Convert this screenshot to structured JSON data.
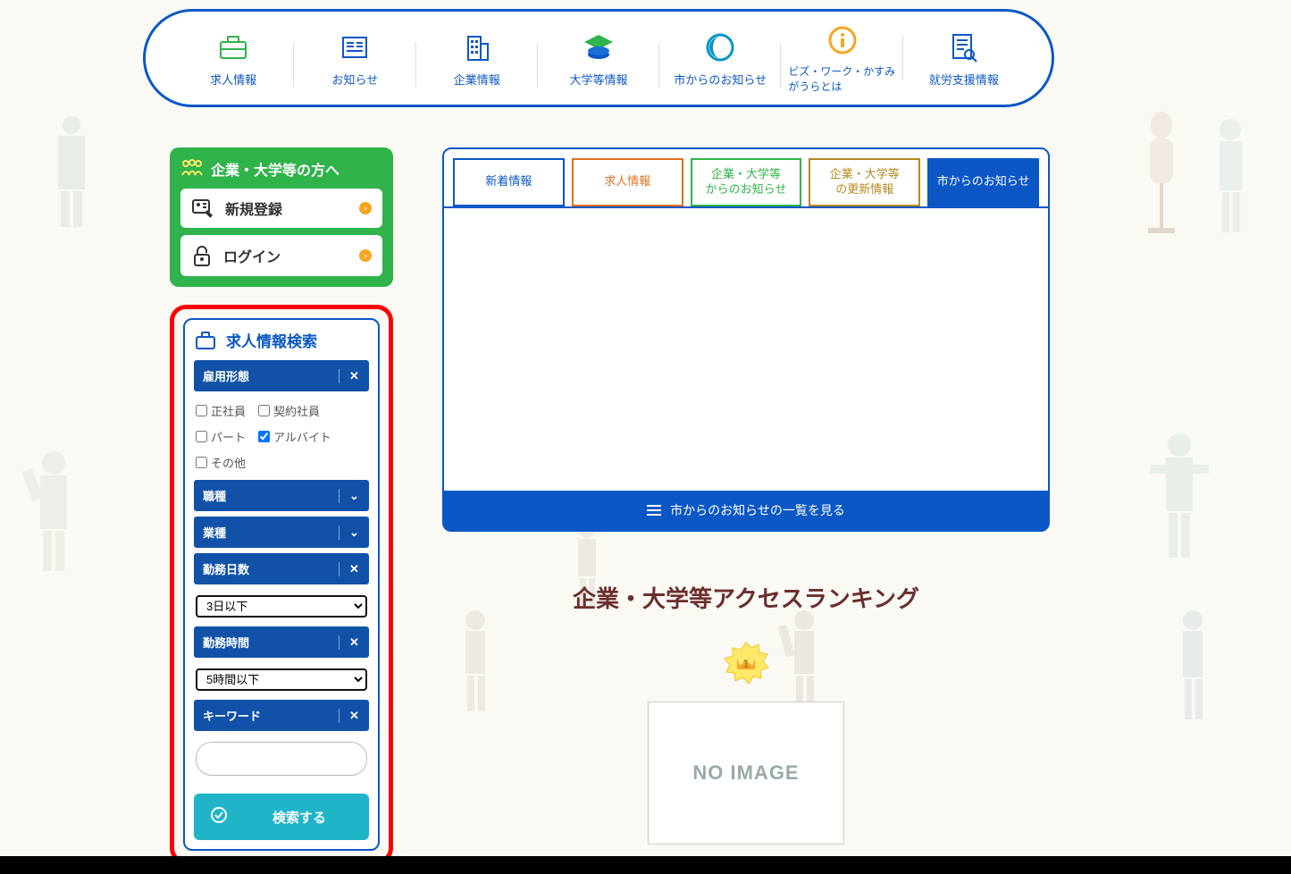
{
  "nav": [
    {
      "label": "求人情報",
      "icon": "briefcase"
    },
    {
      "label": "お知らせ",
      "icon": "news"
    },
    {
      "label": "企業情報",
      "icon": "building"
    },
    {
      "label": "大学等情報",
      "icon": "graduation"
    },
    {
      "label": "市からのお知らせ",
      "icon": "crescent"
    },
    {
      "label": "ビズ・ワーク・かすみがうらとは",
      "icon": "info"
    },
    {
      "label": "就労支援情報",
      "icon": "doc-search"
    }
  ],
  "companyBox": {
    "title": "企業・大学等の方へ",
    "register": "新規登録",
    "login": "ログイン"
  },
  "search": {
    "title": "求人情報検索",
    "filters": {
      "employment": {
        "label": "雇用形態",
        "options": [
          {
            "label": "正社員",
            "checked": false
          },
          {
            "label": "契約社員",
            "checked": false
          },
          {
            "label": "パート",
            "checked": false
          },
          {
            "label": "アルバイト",
            "checked": true
          },
          {
            "label": "その他",
            "checked": false
          }
        ]
      },
      "jobType": {
        "label": "職種"
      },
      "industry": {
        "label": "業種"
      },
      "workDays": {
        "label": "勤務日数",
        "selected": "3日以下"
      },
      "workHours": {
        "label": "勤務時間",
        "selected": "5時間以下"
      },
      "keyword": {
        "label": "キーワード",
        "value": ""
      }
    },
    "button": "検索する"
  },
  "tabs": [
    {
      "label": "新着情報",
      "style": "blue"
    },
    {
      "label": "求人情報",
      "style": "orange"
    },
    {
      "label": "企業・大学等\nからのお知らせ",
      "style": "green"
    },
    {
      "label": "企業・大学等\nの更新情報",
      "style": "gold"
    },
    {
      "label": "市からのお知らせ",
      "style": "active"
    }
  ],
  "cardFooter": "市からのお知らせの一覧を見る",
  "ranking": {
    "title": "企業・大学等アクセスランキング",
    "badgeNumber": "1",
    "noimage": "NO IMAGE"
  }
}
